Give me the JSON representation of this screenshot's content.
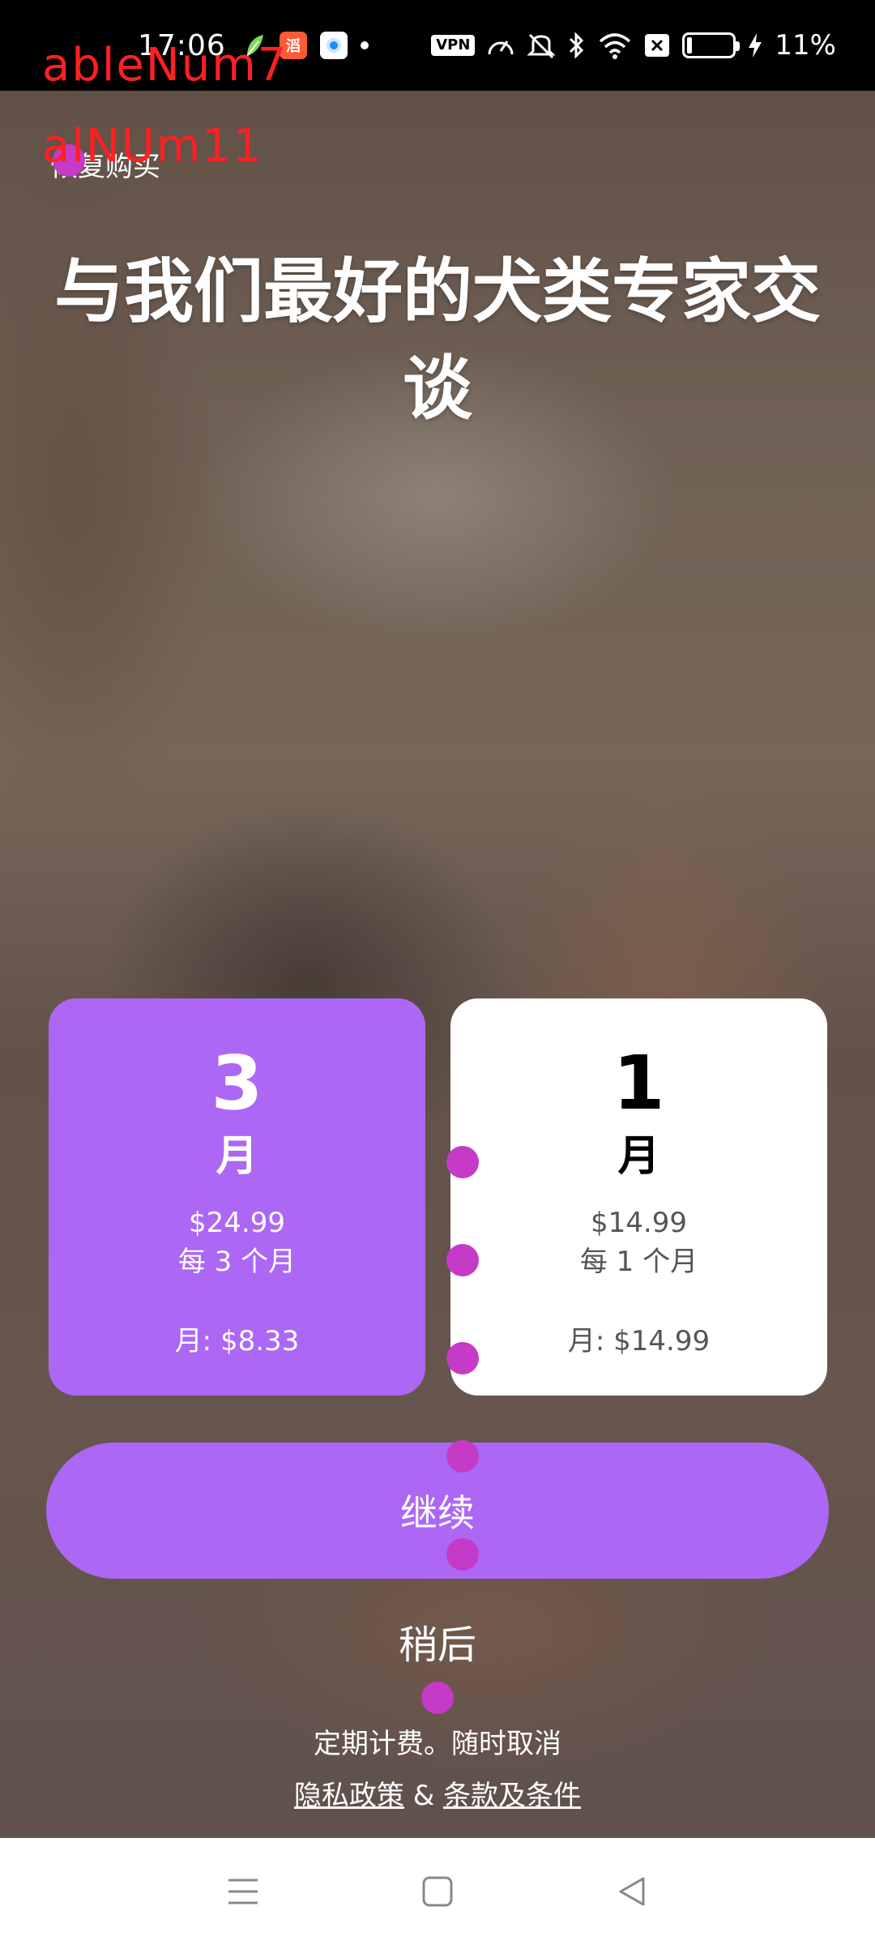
{
  "status_bar": {
    "time": "17:06",
    "app_badge_text": "滔",
    "vpn_label": "VPN",
    "battery_percent": "11%",
    "icons": [
      "leaf-icon",
      "app-badge-icon",
      "browser-icon",
      "dot-icon",
      "vpn-icon",
      "speed-icon",
      "mute-icon",
      "bluetooth-icon",
      "wifi-icon",
      "sim-x-icon",
      "battery-icon",
      "charging-icon"
    ]
  },
  "overlay": {
    "label_top": "ableNum7",
    "label_second": "alNUm11"
  },
  "header": {
    "restore_label": "恢复购买",
    "headline": "与我们最好的犬类专家交谈"
  },
  "plans": [
    {
      "number": "3",
      "unit": "月",
      "price": "$24.99",
      "period": "每 3 个月",
      "monthly": "月: $8.33",
      "selected": true
    },
    {
      "number": "1",
      "unit": "月",
      "price": "$14.99",
      "period": "每 1 个月",
      "monthly": "月: $14.99",
      "selected": false
    }
  ],
  "actions": {
    "continue_label": "继续",
    "later_label": "稍后"
  },
  "footer": {
    "billing_note": "定期计费。随时取消",
    "privacy_label": "隐私政策",
    "separator": "&",
    "terms_label": "条款及条件"
  },
  "colors": {
    "accent": "#ac67f5",
    "marker": "#c53ac6",
    "overlay_text": "#ff2020"
  }
}
